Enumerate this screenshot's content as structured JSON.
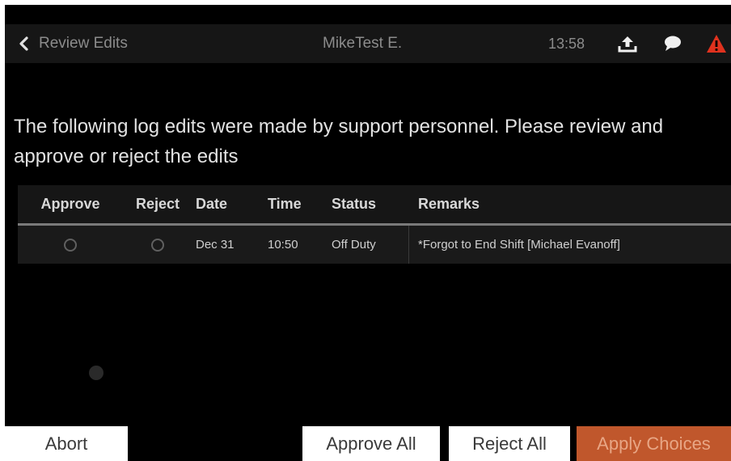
{
  "header": {
    "back_label": "Review Edits",
    "driver": "MikeTest E.",
    "time": "13:58",
    "icons": [
      "upload-icon",
      "chat-icon",
      "warning-icon"
    ],
    "warning_color": "#e0321e"
  },
  "message": "The following log edits were made by support personnel. Please review and approve or reject the edits",
  "table": {
    "columns": [
      "Approve",
      "Reject",
      "Date",
      "Time",
      "Status",
      "Remarks"
    ],
    "rows": [
      {
        "approve": false,
        "reject": false,
        "date": "Dec 31",
        "time": "10:50",
        "status": "Off Duty",
        "remarks": "*Forgot to End Shift [Michael Evanoff]"
      }
    ]
  },
  "buttons": {
    "abort": "Abort",
    "approve_all": "Approve All",
    "reject_all": "Reject All",
    "apply": "Apply Choices"
  },
  "colors": {
    "accent": "#c0572c",
    "background": "#000000"
  }
}
